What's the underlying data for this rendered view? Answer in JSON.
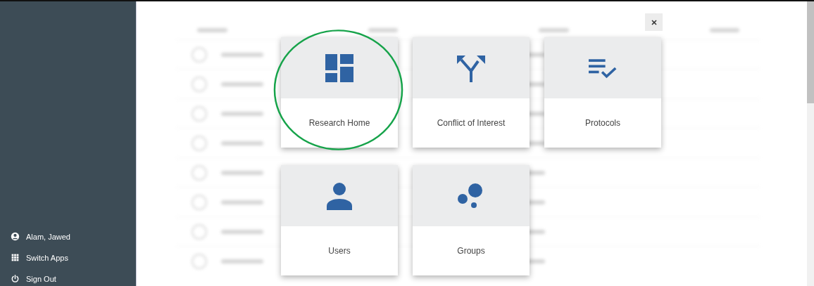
{
  "sidebar": {
    "items": [
      {
        "kind": "user",
        "label": "Alam, Jawed"
      },
      {
        "kind": "apps",
        "label": "Switch Apps"
      },
      {
        "kind": "signout",
        "label": "Sign Out"
      }
    ]
  },
  "app_switcher": {
    "tiles": [
      {
        "kind": "dashboard",
        "label": "Research Home",
        "highlighted": true
      },
      {
        "kind": "split",
        "label": "Conflict of Interest",
        "highlighted": false
      },
      {
        "kind": "checklist",
        "label": "Protocols",
        "highlighted": false
      },
      {
        "kind": "person",
        "label": "Users",
        "highlighted": false
      },
      {
        "kind": "bubbles",
        "label": "Groups",
        "highlighted": false
      }
    ]
  }
}
